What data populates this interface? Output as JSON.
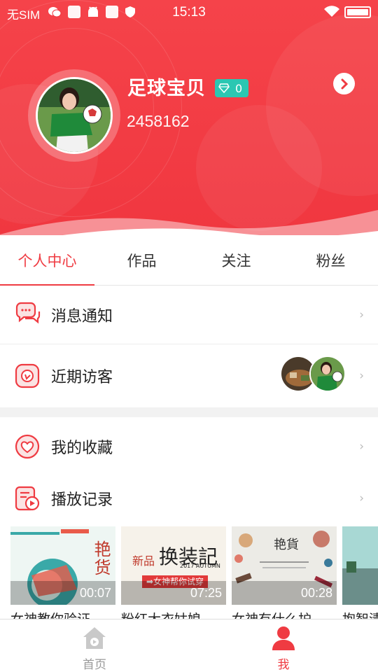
{
  "status_bar": {
    "carrier": "无SIM",
    "time": "15:13",
    "battery_level": 1.0
  },
  "profile": {
    "username": "足球宝贝",
    "level": "0",
    "user_id": "2458162"
  },
  "tabs": [
    {
      "label": "个人中心",
      "active": true
    },
    {
      "label": "作品",
      "active": false
    },
    {
      "label": "关注",
      "active": false
    },
    {
      "label": "粉丝",
      "active": false
    }
  ],
  "menu": {
    "notifications": {
      "label": "消息通知",
      "icon": "chat-bubbles-icon"
    },
    "visitors": {
      "label": "近期访客",
      "icon": "visitor-icon"
    },
    "favorites": {
      "label": "我的收藏",
      "icon": "heart-icon"
    },
    "history": {
      "label": "播放记录",
      "icon": "play-history-icon"
    }
  },
  "videos": [
    {
      "title": "女神教你验证",
      "duration": "00:07",
      "thumb_text": "艳货"
    },
    {
      "title": "粉红大衣姑娘",
      "duration": "07:25",
      "thumb_text": "换装記",
      "thumb_sub": "新品",
      "thumb_banner": "➡女神帮你试穿",
      "thumb_small": "2017 AUTUMN"
    },
    {
      "title": "女神有什么护",
      "duration": "00:28",
      "thumb_text": "艳貨"
    },
    {
      "title": "抱智清",
      "duration": ""
    }
  ],
  "bottom_nav": [
    {
      "label": "首页",
      "active": false,
      "icon": "home-icon"
    },
    {
      "label": "我",
      "active": true,
      "icon": "person-icon"
    }
  ],
  "colors": {
    "accent": "#ef3b42",
    "badge": "#2bc7b2"
  }
}
